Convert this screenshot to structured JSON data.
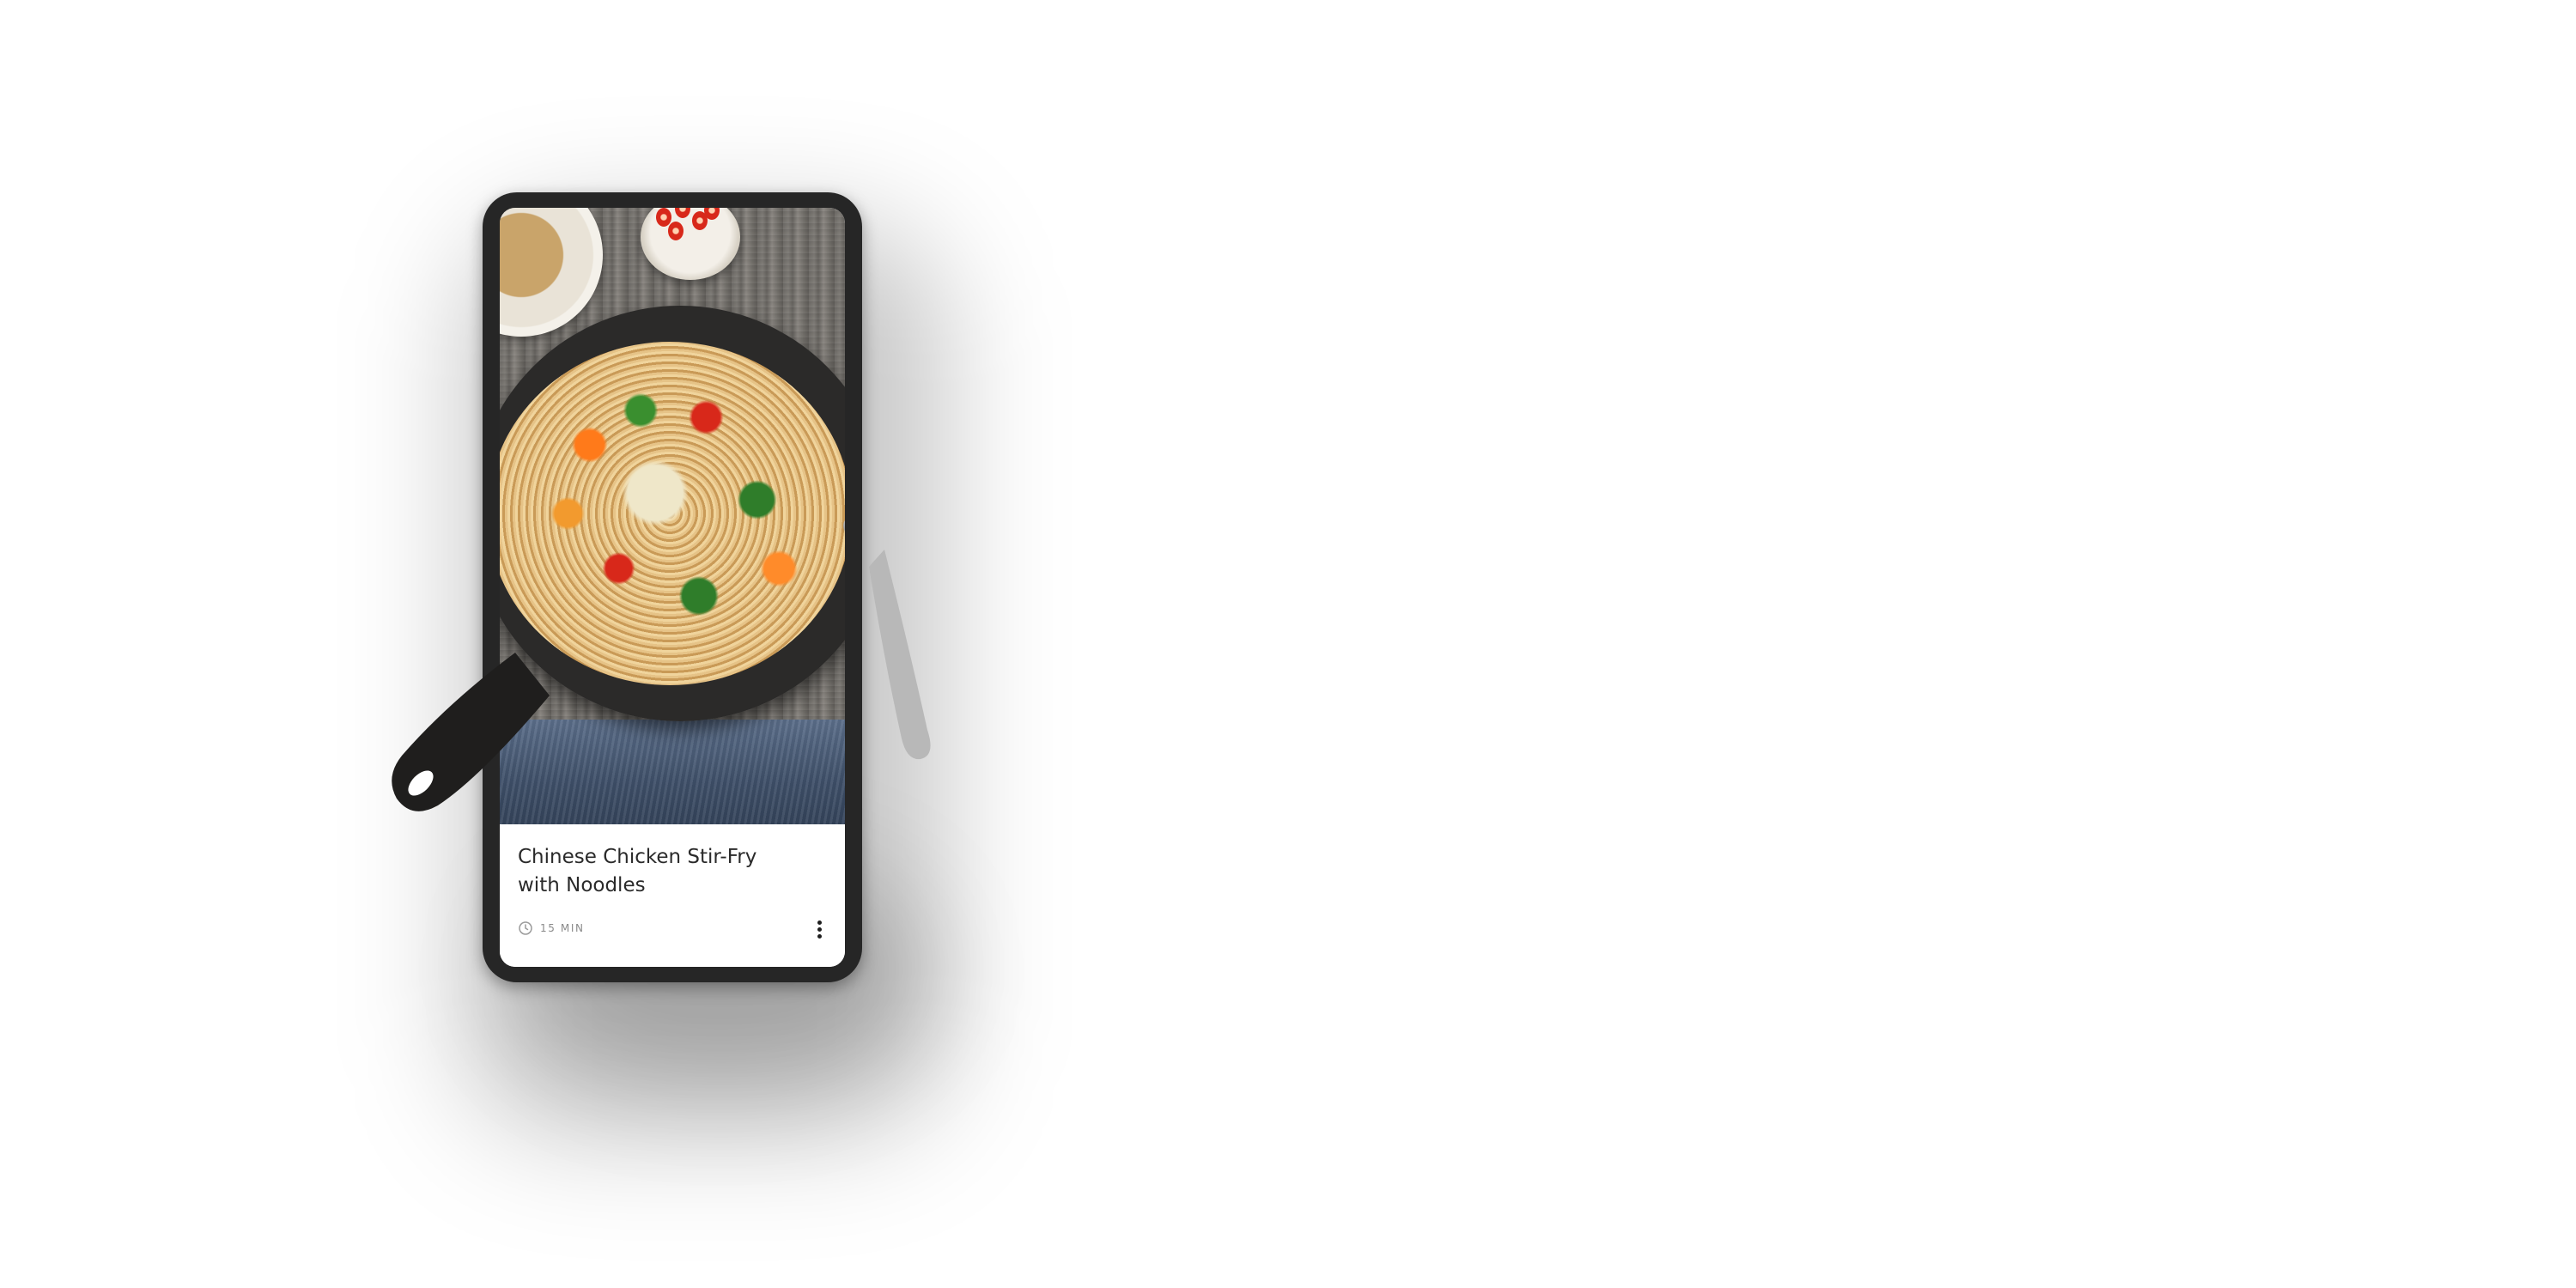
{
  "recipe_card": {
    "title": "Chinese Chicken Stir-Fry with Noodles",
    "cook_time": "15 MIN",
    "image_alt_icon": "food-photo",
    "menu_icon": "more-vertical-icon",
    "time_icon": "clock-icon"
  },
  "colors": {
    "background": "#ffffff",
    "device_frame": "#262626",
    "title_text": "#2a2a2a",
    "meta_text": "#8a8a8a"
  }
}
